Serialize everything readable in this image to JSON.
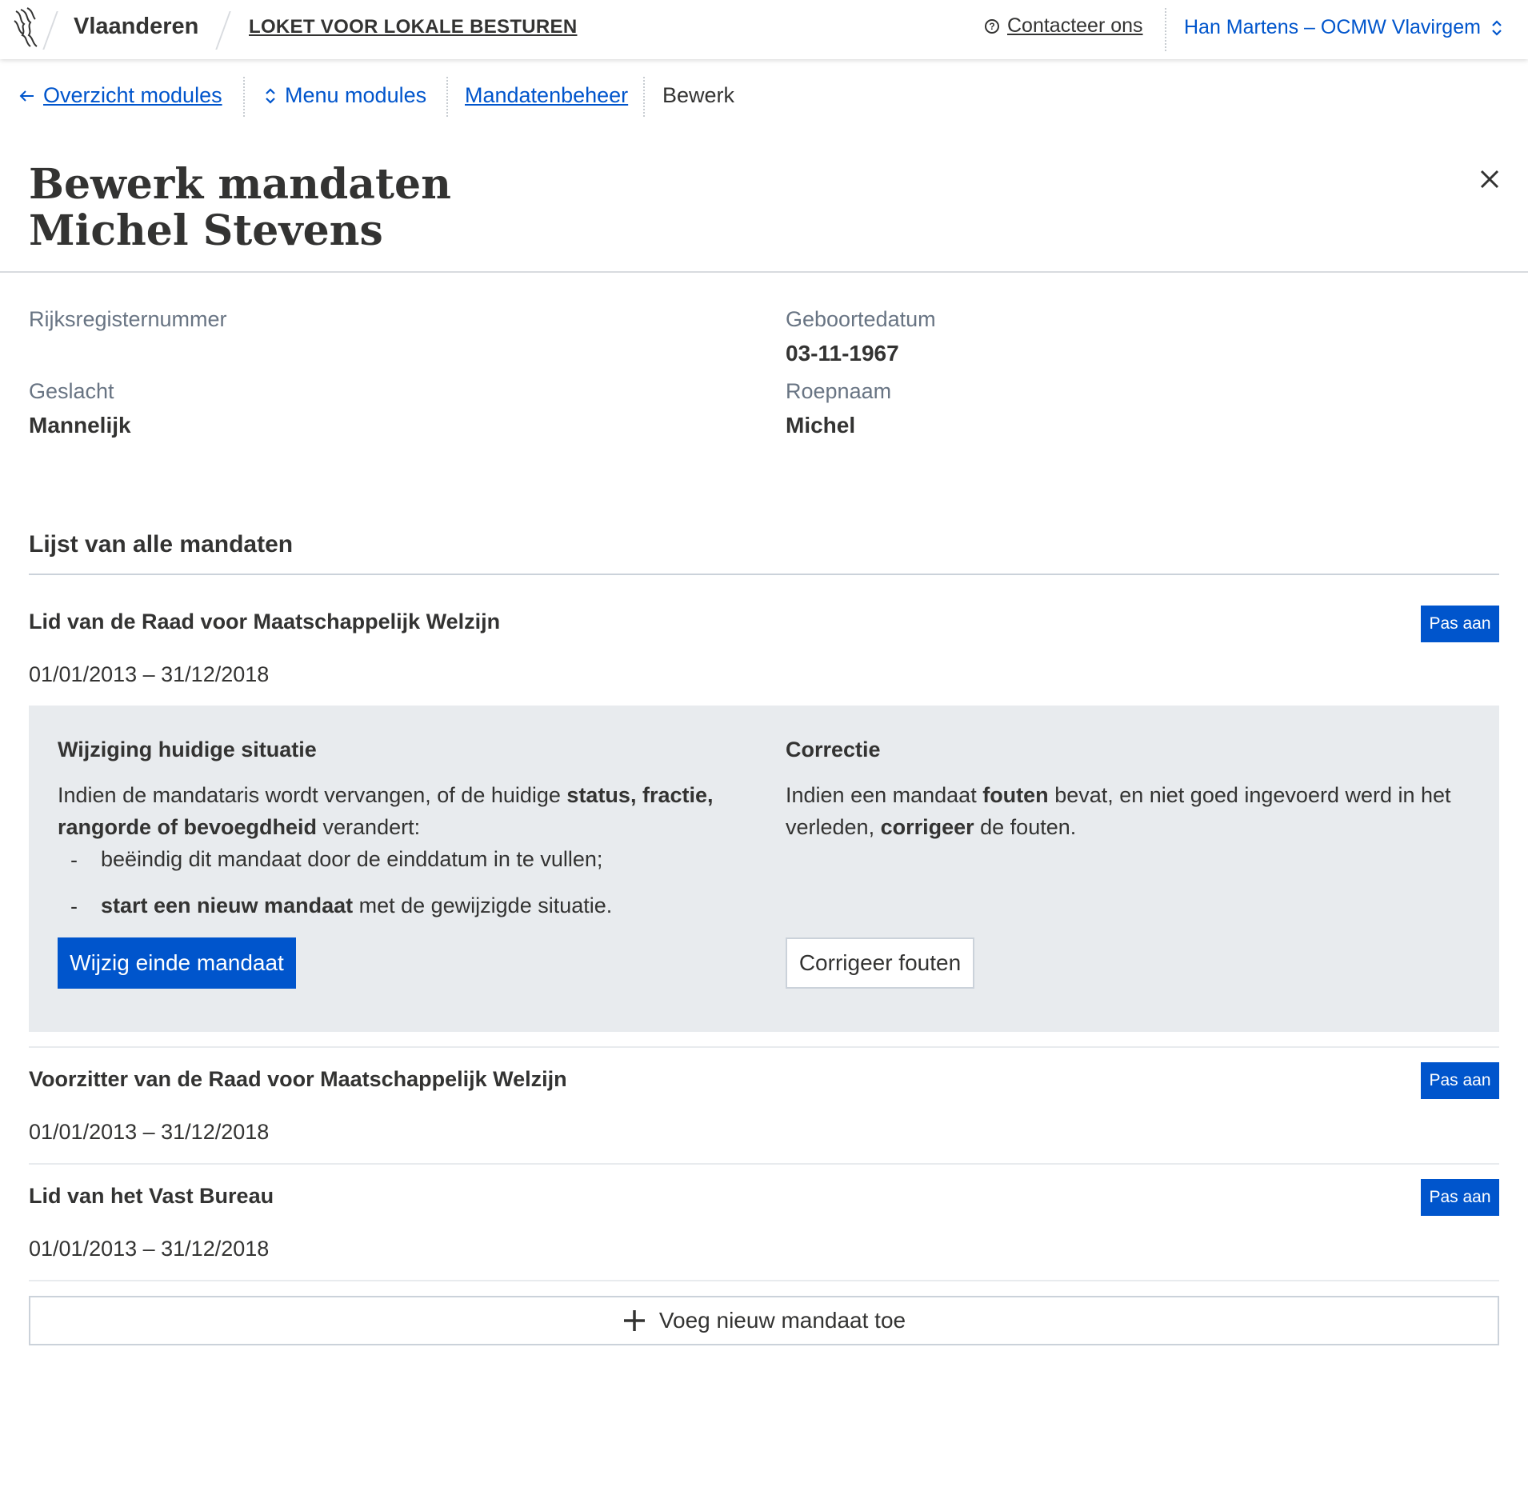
{
  "header": {
    "brand": "Vlaanderen",
    "app_title": "LOKET VOOR LOKALE BESTUREN",
    "contact_label": "Contacteer ons",
    "user_label": "Han Martens – OCMW Vlavirgem"
  },
  "breadcrumb": {
    "back_label": "Overzicht modules",
    "menu_label": "Menu modules",
    "parent_label": "Mandatenbeheer",
    "current_label": "Bewerk"
  },
  "page": {
    "title_line1": "Bewerk mandaten",
    "title_line2": "Michel Stevens"
  },
  "person": {
    "rrn_label": "Rijksregisternummer",
    "rrn_value": "",
    "birth_label": "Geboortedatum",
    "birth_value": "03-11-1967",
    "gender_label": "Geslacht",
    "gender_value": "Mannelijk",
    "nickname_label": "Roepnaam",
    "nickname_value": "Michel"
  },
  "mandates": {
    "section_title": "Lijst van alle mandaten",
    "edit_label": "Pas aan",
    "items": [
      {
        "title": "Lid van de Raad voor Maatschappelijk Welzijn",
        "period": "01/01/2013 – 31/12/2018"
      },
      {
        "title": "Voorzitter van de Raad voor Maatschappelijk Welzijn",
        "period": "01/01/2013 – 31/12/2018"
      },
      {
        "title": "Lid van het Vast Bureau",
        "period": "01/01/2013 – 31/12/2018"
      }
    ],
    "add_label": "Voeg nieuw mandaat toe"
  },
  "panel": {
    "left_heading": "Wijziging huidige situatie",
    "left_intro_1": "Indien de mandataris wordt vervangen, of de huidige ",
    "left_intro_bold_1": "status, fractie,",
    "left_intro_bold_2": "rangorde of bevoegdheid",
    "left_intro_2": " verandert:",
    "bullet_1": "beëindig dit mandaat door de einddatum in te vullen;",
    "bullet_2_bold": "start een nieuw mandaat",
    "bullet_2_rest": " met de gewijzigde situatie.",
    "primary_button": "Wijzig einde mandaat",
    "right_heading": "Correctie",
    "right_text_1": "Indien een mandaat ",
    "right_text_bold_1": "fouten",
    "right_text_2": " bevat, en niet goed ingevoerd werd in het verleden, ",
    "right_text_bold_2": "corrigeer",
    "right_text_3": " de fouten.",
    "secondary_button": "Corrigeer fouten"
  },
  "colors": {
    "accent": "#0055cc",
    "text": "#333332",
    "muted": "#687483",
    "panel_bg": "#e8ebee"
  }
}
